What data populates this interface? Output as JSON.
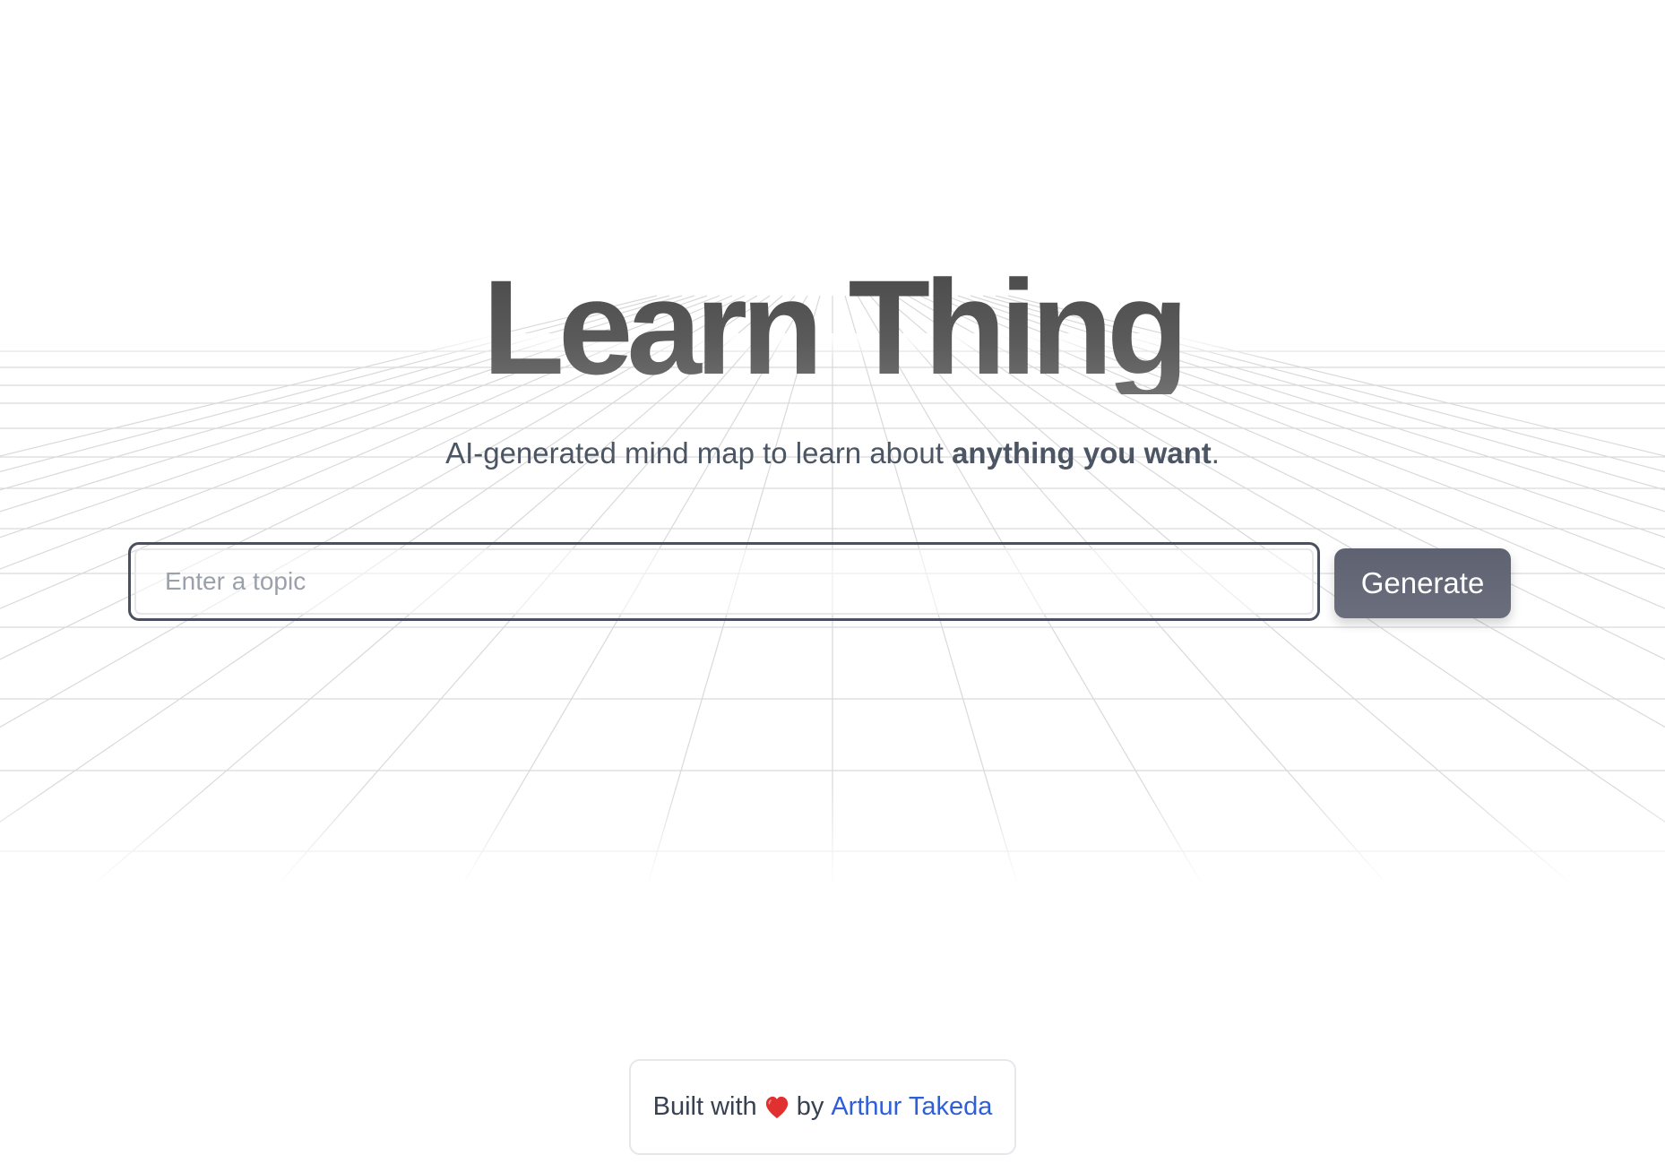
{
  "app": {
    "title": "Learn Thing",
    "subtitle_prefix": "AI-generated mind map to learn about ",
    "subtitle_emphasis": "anything you want",
    "subtitle_suffix": "."
  },
  "search": {
    "placeholder": "Enter a topic",
    "value": ""
  },
  "actions": {
    "generate_label": "Generate"
  },
  "footer": {
    "built_with": "Built with",
    "by": "by",
    "author": "Arthur Takeda",
    "heart_icon": "heart-icon"
  },
  "colors": {
    "title": "#555555",
    "text": "#4b5563",
    "button_bg": "#616473",
    "input_border": "#4b5060",
    "link": "#2f5fd8",
    "heart": "#e0302f"
  }
}
